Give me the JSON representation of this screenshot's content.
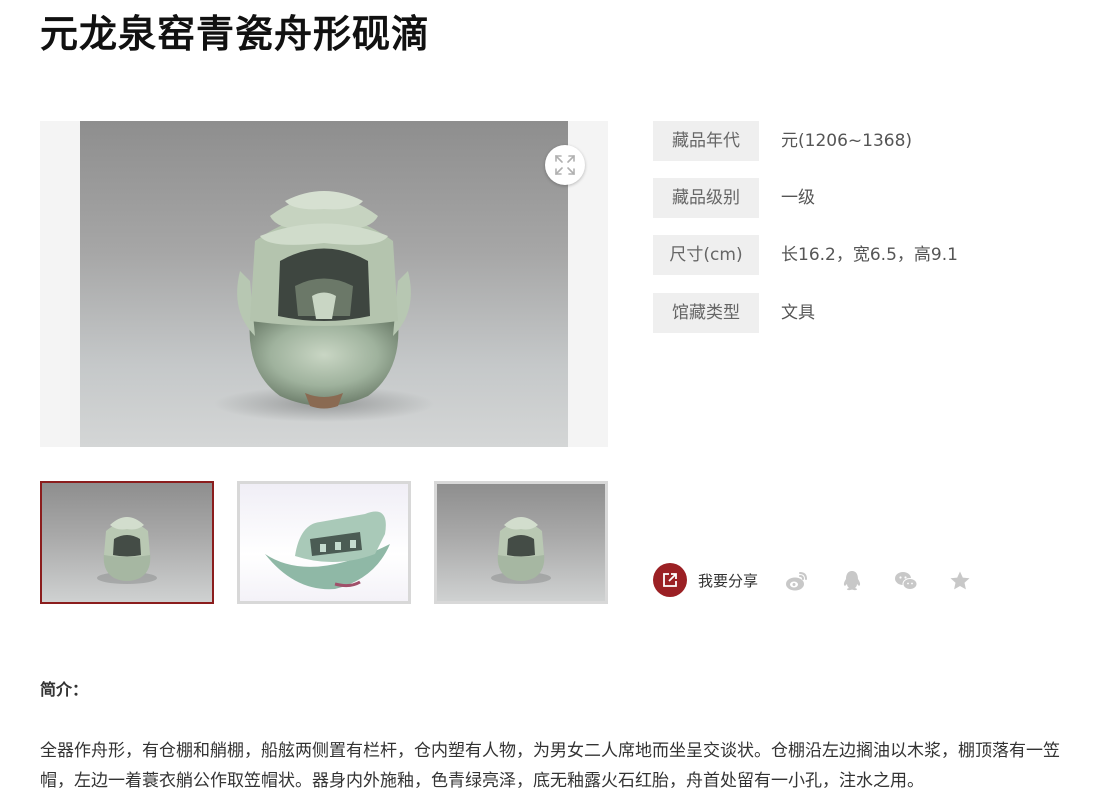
{
  "page": {
    "title": "元龙泉窑青瓷舟形砚滴"
  },
  "gallery": {
    "main_image_alt": "元龙泉窑青瓷舟形砚滴",
    "thumbnails": [
      {
        "alt": "正面",
        "selected": true
      },
      {
        "alt": "侧面",
        "selected": false
      },
      {
        "alt": "正面",
        "selected": false
      }
    ]
  },
  "attributes": [
    {
      "key": "藏品年代",
      "value": "元(1206~1368)"
    },
    {
      "key": "藏品级别",
      "value": "一级"
    },
    {
      "key": "尺寸(cm)",
      "value": "长16.2，宽6.5，高9.1"
    },
    {
      "key": "馆藏类型",
      "value": "文具"
    }
  ],
  "share": {
    "label": "我要分享",
    "icons": [
      "share-icon",
      "weibo-icon",
      "qq-icon",
      "wechat-icon",
      "star-icon"
    ],
    "accent": "#9b2024",
    "icon_color": "#c8c8c8"
  },
  "intro": {
    "heading": "简介：",
    "text": "全器作舟形，有仓棚和艄棚，船舷两侧置有栏杆，仓内塑有人物，为男女二人席地而坐呈交谈状。仓棚沿左边搁油以木浆，棚顶落有一笠帽，左边一着蓑衣艄公作取笠帽状。器身内外施釉，色青绿亮泽，底无釉露火石红胎，舟首处留有一小孔，注水之用。"
  }
}
